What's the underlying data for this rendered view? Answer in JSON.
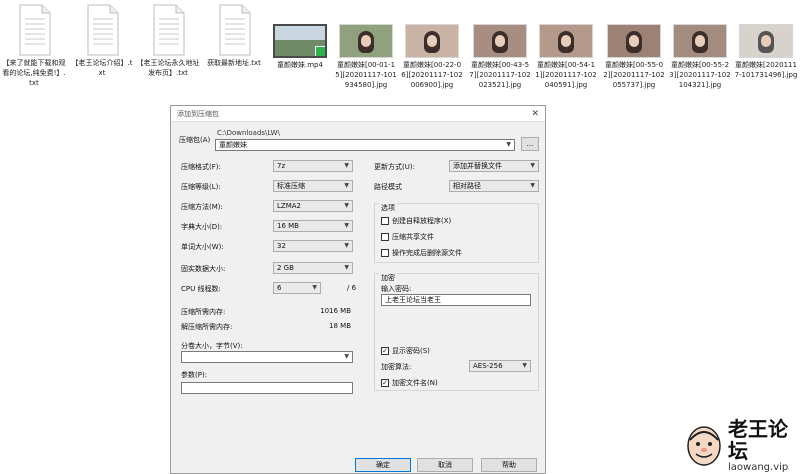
{
  "files": [
    {
      "name": "【来了就能下载和观看的论坛,纯免费!】.txt",
      "kind": "doc"
    },
    {
      "name": "【老王论坛介绍】.txt",
      "kind": "doc"
    },
    {
      "name": "【老王论坛永久地址发布页】.txt",
      "kind": "doc"
    },
    {
      "name": "获取最新地址.txt",
      "kind": "doc"
    },
    {
      "name": "童颜嫩妹.mp4",
      "kind": "video"
    },
    {
      "name": "童颜嫩妹[00-01-15][20201117-101934580].jpg",
      "kind": "image"
    },
    {
      "name": "童颜嫩妹[00-22-06][20201117-102006900].jpg",
      "kind": "image"
    },
    {
      "name": "童颜嫩妹[00-43-57][20201117-102023521].jpg",
      "kind": "image"
    },
    {
      "name": "童颜嫩妹[00-54-11][20201117-102040591].jpg",
      "kind": "image"
    },
    {
      "name": "童颜嫩妹[00-55-02][20201117-102055737].jpg",
      "kind": "image"
    },
    {
      "name": "童颜嫩妹[00-55-23][20201117-102104321].jpg",
      "kind": "image"
    },
    {
      "name": "童颜嫩妹[20201117-101731496].jpg",
      "kind": "image"
    }
  ],
  "dialog": {
    "title": "添加到压缩包",
    "close": "✕",
    "archive_label": "压缩包(A)",
    "archive_path": "C:\\Downloads\\LW\\",
    "archive_name": "童颜嫩妹",
    "browse": "...",
    "format_label": "压缩格式(F):",
    "format_value": "7z",
    "level_label": "压缩等级(L):",
    "level_value": "标准压缩",
    "method_label": "压缩方法(M):",
    "method_value": "LZMA2",
    "dict_label": "字典大小(D):",
    "dict_value": "16 MB",
    "word_label": "单词大小(W):",
    "word_value": "32",
    "solid_label": "固实数据大小:",
    "solid_value": "2 GB",
    "cpu_label": "CPU 线程数:",
    "cpu_value": "6",
    "cpu_total": "/ 6",
    "mem_comp_label": "压缩所需内存:",
    "mem_comp_value": "1016 MB",
    "mem_decomp_label": "解压缩所需内存:",
    "mem_decomp_value": "18 MB",
    "split_label": "分卷大小，字节(V):",
    "split_value": "",
    "params_label": "参数(P):",
    "params_value": "",
    "update_label": "更新方式(U):",
    "update_value": "添加并替换文件",
    "path_label": "路径模式",
    "path_value": "相对路径",
    "options_title": "选项",
    "opt_sfx": "创建自释放程序(X)",
    "opt_shared": "压缩共享文件",
    "opt_delete": "操作完成后删除源文件",
    "encrypt_title": "加密",
    "password_label": "输入密码:",
    "password_value": "上老王论坛当老王",
    "show_password": "显示密码(S)",
    "enc_method_label": "加密算法:",
    "enc_method_value": "AES-256",
    "encrypt_names": "加密文件名(N)",
    "ok": "确定",
    "cancel": "取消",
    "help": "帮助"
  },
  "watermark": {
    "title": "老王论坛",
    "url": "laowang.vip"
  }
}
